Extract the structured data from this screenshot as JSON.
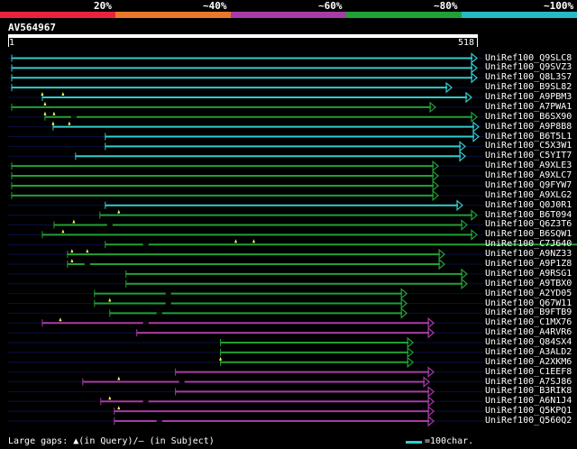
{
  "scale": {
    "labels": [
      "20%",
      "~40%",
      "~60%",
      "~80%",
      "~100%"
    ],
    "colors": [
      "#e8243c",
      "#e8792b",
      "#a73ca6",
      "#22a035",
      "#27b9c6"
    ]
  },
  "query": {
    "id": "AV564967",
    "start": "1",
    "end": "518",
    "length": 518
  },
  "hits": [
    {
      "name": "UniRef100_Q9SLC8",
      "s": 1,
      "e": 518,
      "c": "cyan",
      "gaps": []
    },
    {
      "name": "UniRef100_Q9SVZ3",
      "s": 1,
      "e": 518,
      "c": "cyan",
      "gaps": []
    },
    {
      "name": "UniRef100_Q8L3S7",
      "s": 1,
      "e": 518,
      "c": "cyan",
      "gaps": []
    },
    {
      "name": "UniRef100_B9SL82",
      "s": 1,
      "e": 490,
      "c": "cyan",
      "gaps": []
    },
    {
      "name": "UniRef100_A9PBM3",
      "s": 35,
      "e": 512,
      "c": "cyan",
      "gaps": [
        {
          "p": 35,
          "t": "q"
        },
        {
          "p": 58,
          "t": "q"
        }
      ]
    },
    {
      "name": "UniRef100_A7PWA1",
      "s": 1,
      "e": 472,
      "c": "green",
      "gaps": [
        {
          "p": 38,
          "t": "q"
        }
      ]
    },
    {
      "name": "UniRef100_B6SX90",
      "s": 38,
      "e": 518,
      "c": "green",
      "gaps": [
        {
          "p": 38,
          "t": "q"
        },
        {
          "p": 48,
          "t": "q"
        },
        {
          "p": 70,
          "t": "s"
        }
      ]
    },
    {
      "name": "UniRef100_A9P8B8",
      "s": 47,
      "e": 520,
      "c": "cyan",
      "gaps": [
        {
          "p": 47,
          "t": "q"
        },
        {
          "p": 65,
          "t": "q"
        }
      ]
    },
    {
      "name": "UniRef100_B6T5L1",
      "s": 105,
      "e": 520,
      "c": "cyan",
      "gaps": []
    },
    {
      "name": "UniRef100_C5X3W1",
      "s": 105,
      "e": 505,
      "c": "cyan",
      "gaps": []
    },
    {
      "name": "UniRef100_C5YIT7",
      "s": 72,
      "e": 505,
      "c": "cyan",
      "gaps": []
    },
    {
      "name": "UniRef100_A9XLE3",
      "s": 1,
      "e": 475,
      "c": "green",
      "gaps": []
    },
    {
      "name": "UniRef100_A9XLC7",
      "s": 1,
      "e": 475,
      "c": "green",
      "gaps": []
    },
    {
      "name": "UniRef100_Q9FYW7",
      "s": 1,
      "e": 475,
      "c": "green",
      "gaps": []
    },
    {
      "name": "UniRef100_A9XLG2",
      "s": 1,
      "e": 475,
      "c": "green",
      "gaps": []
    },
    {
      "name": "UniRef100_Q0J0R1",
      "s": 105,
      "e": 502,
      "c": "cyan",
      "gaps": []
    },
    {
      "name": "UniRef100_B6T094",
      "s": 99,
      "e": 518,
      "c": "green",
      "gaps": [
        {
          "p": 120,
          "t": "q"
        }
      ]
    },
    {
      "name": "UniRef100_Q6Z3T6",
      "s": 48,
      "e": 507,
      "c": "green",
      "gaps": [
        {
          "p": 70,
          "t": "q"
        },
        {
          "p": 110,
          "t": "s"
        }
      ]
    },
    {
      "name": "UniRef100_B6SQW1",
      "s": 35,
      "e": 518,
      "c": "green",
      "gaps": [
        {
          "p": 58,
          "t": "q"
        }
      ]
    },
    {
      "name": "UniRef100_C7J640",
      "s": 105,
      "e": 648,
      "c": "green",
      "gaps": [
        {
          "p": 250,
          "t": "q"
        },
        {
          "p": 270,
          "t": "q"
        },
        {
          "p": 150,
          "t": "s"
        }
      ]
    },
    {
      "name": "UniRef100_A9NZ33",
      "s": 63,
      "e": 482,
      "c": "green",
      "gaps": [
        {
          "p": 68,
          "t": "q"
        },
        {
          "p": 85,
          "t": "q"
        }
      ]
    },
    {
      "name": "UniRef100_A9P1Z8",
      "s": 63,
      "e": 482,
      "c": "green",
      "gaps": [
        {
          "p": 68,
          "t": "q"
        },
        {
          "p": 85,
          "t": "s"
        }
      ]
    },
    {
      "name": "UniRef100_A9RSG1",
      "s": 128,
      "e": 507,
      "c": "green",
      "gaps": []
    },
    {
      "name": "UniRef100_A9TBX0",
      "s": 128,
      "e": 507,
      "c": "green",
      "gaps": []
    },
    {
      "name": "UniRef100_A2YD05",
      "s": 93,
      "e": 440,
      "c": "green",
      "gaps": [
        {
          "p": 175,
          "t": "s"
        }
      ]
    },
    {
      "name": "UniRef100_Q67W11",
      "s": 93,
      "e": 440,
      "c": "green",
      "gaps": [
        {
          "p": 110,
          "t": "q"
        },
        {
          "p": 175,
          "t": "s"
        }
      ]
    },
    {
      "name": "UniRef100_B9FTB9",
      "s": 110,
      "e": 440,
      "c": "green",
      "gaps": [
        {
          "p": 165,
          "t": "s"
        }
      ]
    },
    {
      "name": "UniRef100_C1MX76",
      "s": 35,
      "e": 470,
      "c": "magenta",
      "gaps": [
        {
          "p": 55,
          "t": "q"
        },
        {
          "p": 150,
          "t": "s"
        }
      ]
    },
    {
      "name": "UniRef100_A4RVR6",
      "s": 140,
      "e": 470,
      "c": "magenta",
      "gaps": []
    },
    {
      "name": "UniRef100_Q84SX4",
      "s": 233,
      "e": 447,
      "c": "green",
      "gaps": []
    },
    {
      "name": "UniRef100_A3ALD2",
      "s": 233,
      "e": 447,
      "c": "green",
      "gaps": []
    },
    {
      "name": "UniRef100_A2XKM6",
      "s": 233,
      "e": 447,
      "c": "green",
      "gaps": [
        {
          "p": 233,
          "t": "q"
        }
      ]
    },
    {
      "name": "UniRef100_C1EEF8",
      "s": 183,
      "e": 470,
      "c": "magenta",
      "gaps": []
    },
    {
      "name": "UniRef100_A7SJ86",
      "s": 80,
      "e": 465,
      "c": "magenta",
      "gaps": [
        {
          "p": 120,
          "t": "q"
        },
        {
          "p": 190,
          "t": "s"
        }
      ]
    },
    {
      "name": "UniRef100_B3RIK8",
      "s": 183,
      "e": 470,
      "c": "magenta",
      "gaps": []
    },
    {
      "name": "UniRef100_A6N1J4",
      "s": 100,
      "e": 470,
      "c": "magenta",
      "gaps": [
        {
          "p": 110,
          "t": "q"
        },
        {
          "p": 150,
          "t": "s"
        }
      ]
    },
    {
      "name": "UniRef100_Q5KPQ1",
      "s": 115,
      "e": 470,
      "c": "magenta",
      "gaps": [
        {
          "p": 120,
          "t": "q"
        }
      ]
    },
    {
      "name": "UniRef100_Q560Q2",
      "s": 115,
      "e": 470,
      "c": "magenta",
      "gaps": [
        {
          "p": 165,
          "t": "s"
        }
      ]
    }
  ],
  "colors": {
    "cyan": "#33cccc",
    "green": "#22a035",
    "magenta": "#a73ca6",
    "row": "#0a1040",
    "gap": "#ffff66"
  },
  "footer": {
    "prefix": "Large gaps: ",
    "query_gap_glyph": "▲",
    "query_gap_text": "(in Query)/",
    "subject_gap_glyph": "—",
    "subject_gap_text": " (in Subject)"
  },
  "legend": {
    "text": "=100char."
  }
}
